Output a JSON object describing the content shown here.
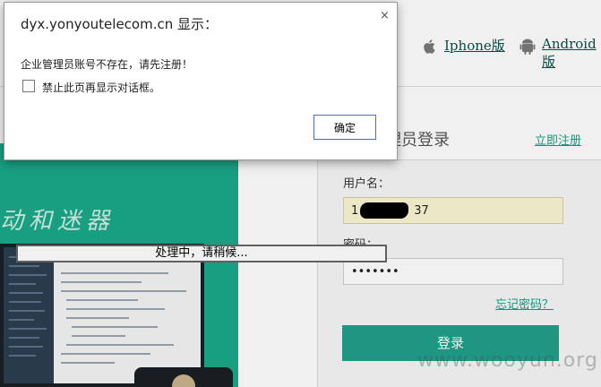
{
  "header": {
    "iphone_label": "Iphone版",
    "android_label": "Android版",
    "iphone_icon": "apple-icon",
    "android_icon": "android-icon"
  },
  "hero": {
    "slogan": "动和迷器"
  },
  "login": {
    "title": "理员登录",
    "register_link": "立即注册",
    "username_label": "用户名：",
    "username_value_prefix": "1",
    "username_value_suffix": "37",
    "password_label": "密码：",
    "password_value": "•••••••",
    "forgot_link": "忘记密码？",
    "submit_label": "登录",
    "accent_color": "#21a08a"
  },
  "processing": {
    "text": "处理中，请稍候..."
  },
  "dialog": {
    "title": "dyx.yonyoutelecom.cn 显示：",
    "close": "×",
    "message": "企业管理员账号不存在，请先注册！",
    "checkbox_label": "禁止此页再显示对话框。",
    "checkbox_checked": false,
    "ok_label": "确定"
  },
  "watermark": "www.wooyun.org"
}
